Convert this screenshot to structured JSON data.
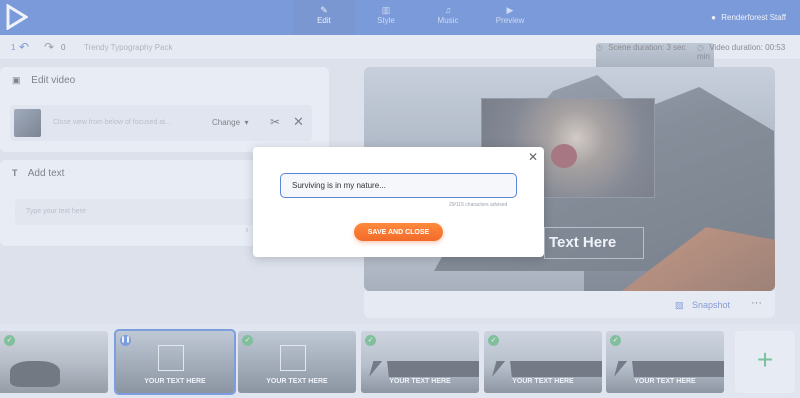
{
  "topbar": {
    "steps": [
      {
        "label": "Edit",
        "icon": "pencil-icon"
      },
      {
        "label": "Style",
        "icon": "brush-icon"
      },
      {
        "label": "Music",
        "icon": "music-note-icon"
      },
      {
        "label": "Preview",
        "icon": "play-icon"
      }
    ],
    "user": "Renderforest Staff",
    "brand_color": "#2b5fc7"
  },
  "toolbar": {
    "undo_count": "1",
    "redo_count": "0",
    "project_name": "Trendy Typography Pack",
    "scene_duration_label": "Scene duration:",
    "scene_duration": "3 sec",
    "video_duration_label": "Video duration:",
    "video_duration": "00:53 min"
  },
  "edit_video": {
    "title": "Edit video",
    "clip_description": "Close view from below of focused at...",
    "change_label": "Change"
  },
  "add_text": {
    "title": "Add text",
    "placeholder": "Type your text here",
    "limit_fragment": "ll"
  },
  "preview": {
    "overlay_text": "Text Here",
    "snapshot_label": "Snapshot",
    "more_label": "···"
  },
  "timeline": {
    "scenes": [
      {
        "text": "",
        "status": "check"
      },
      {
        "text": "YOUR TEXT HERE",
        "status": "selected"
      },
      {
        "text": "YOUR TEXT HERE",
        "status": "check"
      },
      {
        "text": "YOUR TEXT HERE",
        "status": "check"
      },
      {
        "text": "YOUR TEXT HERE",
        "status": "check"
      },
      {
        "text": "YOUR TEXT HERE",
        "status": "check"
      }
    ],
    "add_label": "+"
  },
  "modal": {
    "input_value": "Surviving is in my nature...",
    "char_count": "29/115 characters advised",
    "save_label": "SAVE AND CLOSE",
    "close_label": "✕",
    "accent": "#f26a2a"
  }
}
